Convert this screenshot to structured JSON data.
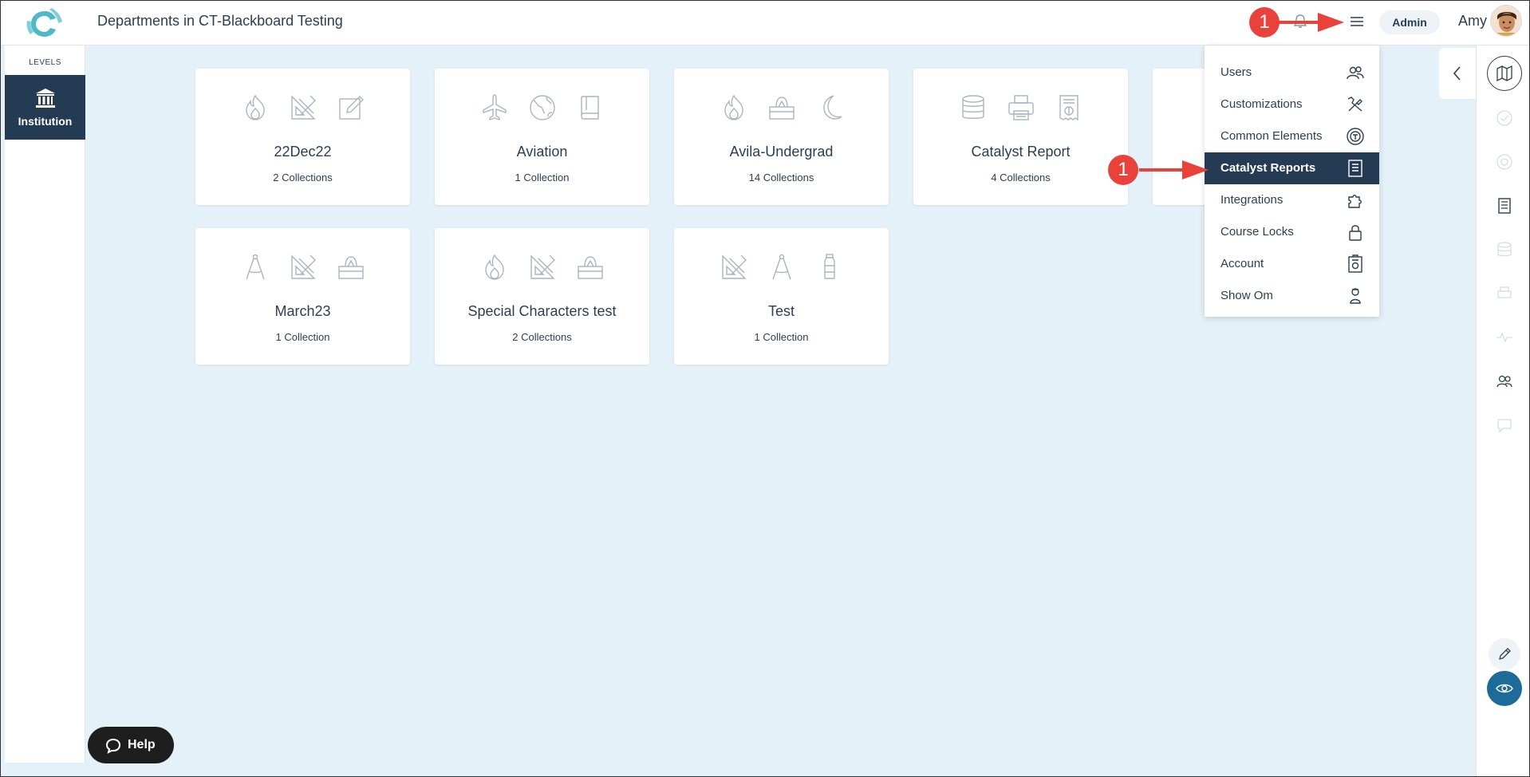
{
  "header": {
    "title": "Departments in CT-Blackboard Testing",
    "admin_label": "Admin",
    "user_name": "Amy"
  },
  "sidebar": {
    "levels_label": "LEVELS",
    "items": [
      {
        "label": "Institution",
        "icon": "institution-icon",
        "active": true
      }
    ]
  },
  "departments": [
    {
      "name": "22Dec22",
      "count": "2 Collections",
      "icons": [
        "flame-icon",
        "triangle-ruler-icon",
        "pencil-square-icon"
      ]
    },
    {
      "name": "Aviation",
      "count": "1 Collection",
      "icons": [
        "airplane-icon",
        "globe-icon",
        "book-icon"
      ]
    },
    {
      "name": "Avila-Undergrad",
      "count": "14 Collections",
      "icons": [
        "flame-icon",
        "tissue-box-icon",
        "moon-icon"
      ]
    },
    {
      "name": "Catalyst Report",
      "count": "4 Collections",
      "icons": [
        "database-icon",
        "printer-icon",
        "receipt-icon"
      ]
    },
    {
      "name": "March23",
      "count": "1 Collection",
      "icons": [
        "compass-icon",
        "triangle-ruler-icon",
        "tissue-box-icon"
      ]
    },
    {
      "name": "Special Characters test",
      "count": "2 Collections",
      "icons": [
        "flame-icon",
        "triangle-ruler-icon",
        "tissue-box-icon"
      ]
    },
    {
      "name": "Test",
      "count": "1 Collection",
      "icons": [
        "triangle-ruler-icon",
        "compass-icon",
        "bottle-icon"
      ]
    }
  ],
  "menu": {
    "items": [
      {
        "label": "Users",
        "icon": "users-icon"
      },
      {
        "label": "Customizations",
        "icon": "tools-icon"
      },
      {
        "label": "Common Elements",
        "icon": "common-elements-icon"
      },
      {
        "label": "Catalyst Reports",
        "icon": "report-icon",
        "active": true
      },
      {
        "label": "Integrations",
        "icon": "puzzle-icon"
      },
      {
        "label": "Course Locks",
        "icon": "lock-icon"
      },
      {
        "label": "Account",
        "icon": "account-icon"
      },
      {
        "label": "Show Om",
        "icon": "om-icon"
      }
    ]
  },
  "annotations": {
    "badge_top": "1",
    "badge_menu": "1"
  },
  "help": {
    "label": "Help"
  },
  "colors": {
    "accent": "#243b53",
    "background": "#e5f1f8",
    "annotation_red": "#e8423b",
    "eye_button": "#1c6b98"
  }
}
